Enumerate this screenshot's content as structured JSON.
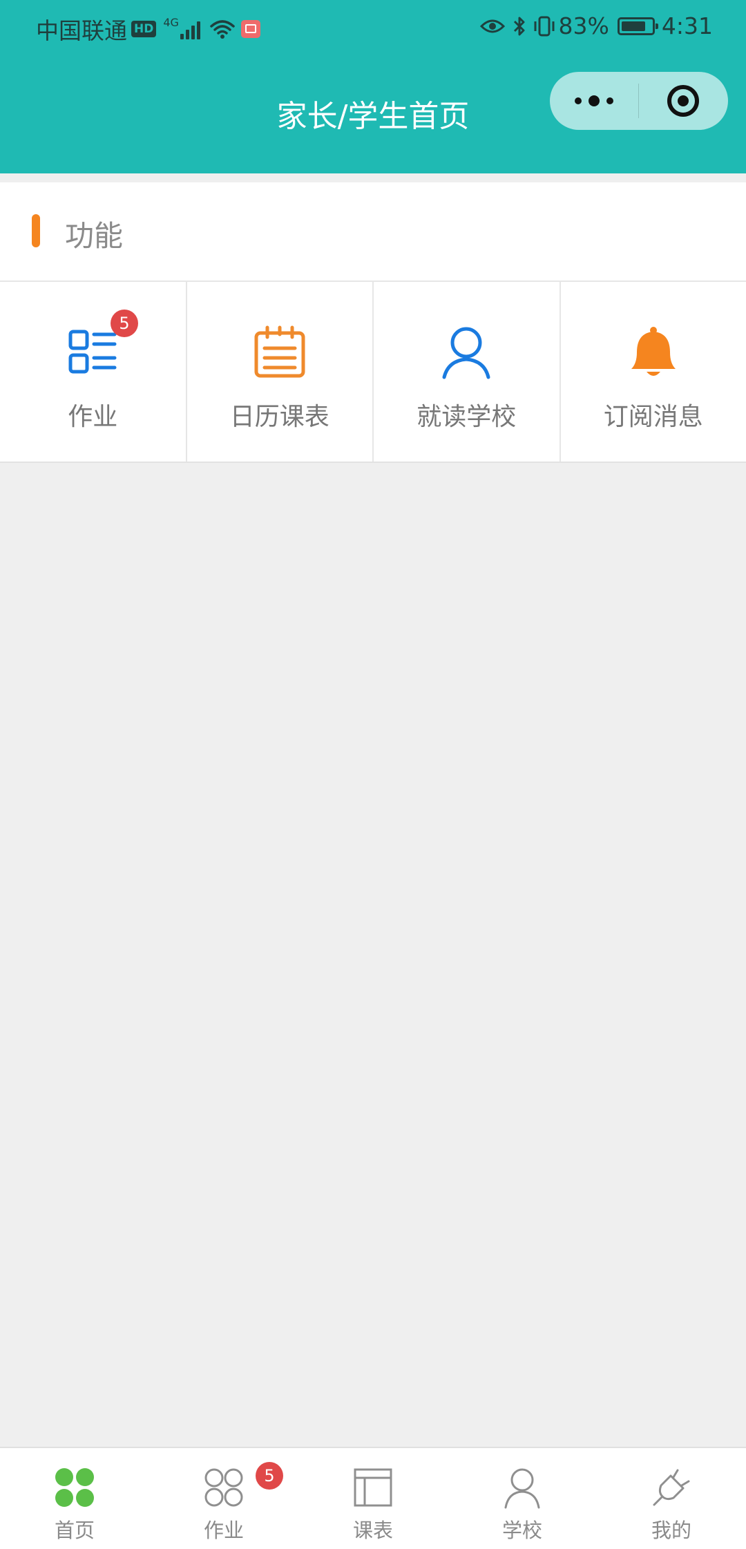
{
  "status_bar": {
    "carrier": "中国联通",
    "hd": "HD",
    "network_type": "4G",
    "battery_percent": "83%",
    "battery_level": 0.83,
    "time": "4:31"
  },
  "nav": {
    "title": "家长/学生首页",
    "more_icon": "more-dots-icon",
    "close_icon": "target-circle-icon"
  },
  "section": {
    "title": "功能",
    "accent_color": "#f5851f"
  },
  "features": [
    {
      "label": "作业",
      "icon": "homework-list-icon",
      "color": "#1a7be0",
      "badge": "5"
    },
    {
      "label": "日历课表",
      "icon": "calendar-icon",
      "color": "#ef8a2c"
    },
    {
      "label": "就读学校",
      "icon": "user-icon",
      "color": "#1a7be0"
    },
    {
      "label": "订阅消息",
      "icon": "bell-icon",
      "color": "#f5851f"
    }
  ],
  "tabbar": {
    "items": [
      {
        "label": "首页",
        "icon": "home-grid-icon",
        "active": true,
        "active_color": "#5bbf48"
      },
      {
        "label": "作业",
        "icon": "homework-circles-icon",
        "badge": "5"
      },
      {
        "label": "课表",
        "icon": "timetable-icon"
      },
      {
        "label": "学校",
        "icon": "school-user-icon"
      },
      {
        "label": "我的",
        "icon": "plug-icon"
      }
    ]
  },
  "colors": {
    "header": "#1fbab3",
    "badge": "#e04848",
    "background": "#efefef"
  }
}
